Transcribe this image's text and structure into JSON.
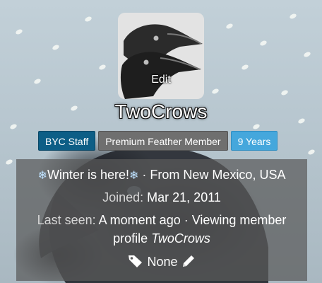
{
  "profile": {
    "avatar_action": "Edit",
    "username": "TwoCrows",
    "badges": [
      "BYC Staff",
      "Premium Feather Member",
      "9 Years"
    ],
    "status": {
      "message": "Winter is here!",
      "location_prefix": "· From",
      "location": "New Mexico, USA"
    },
    "joined": {
      "label": "Joined:",
      "value": "Mar 21, 2011"
    },
    "last_seen": {
      "label": "Last seen:",
      "value": "A moment ago · Viewing member",
      "value_line2": "profile",
      "profile_name": "TwoCrows"
    },
    "tags": {
      "value": "None"
    }
  },
  "icons": {
    "snowflake": "snowflake-icon",
    "tag": "tag-icon",
    "edit": "pencil-icon"
  },
  "colors": {
    "staff_badge": "#0d5e86",
    "premium_badge": "#6f6f6f",
    "years_badge": "#45a7dc"
  }
}
